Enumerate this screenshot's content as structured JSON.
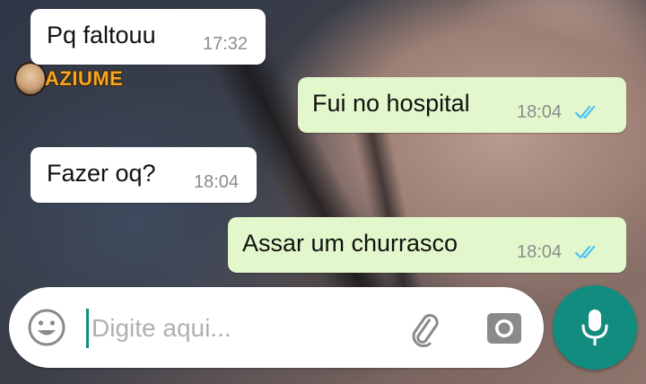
{
  "watermark": {
    "text": "AZIUME"
  },
  "messages": [
    {
      "direction": "incoming",
      "text": "Pq faltouu",
      "time": "17:32"
    },
    {
      "direction": "outgoing",
      "text": "Fui no hospital",
      "time": "18:04",
      "status": "read"
    },
    {
      "direction": "incoming",
      "text": "Fazer oq?",
      "time": "18:04"
    },
    {
      "direction": "outgoing",
      "text": "Assar um churrasco",
      "time": "18:04",
      "status": "read"
    }
  ],
  "composer": {
    "placeholder": "Digite aqui..."
  },
  "icons": {
    "emoji": "emoji-smiley-icon",
    "attach": "paperclip-icon",
    "camera": "camera-icon",
    "mic": "microphone-icon",
    "read_receipt": "double-check-icon"
  },
  "colors": {
    "incoming_bubble": "#ffffff",
    "outgoing_bubble": "#e2f7cb",
    "accent": "#128c7e",
    "read_ticks": "#4fc3f7",
    "timestamp": "#8c8c8c"
  }
}
